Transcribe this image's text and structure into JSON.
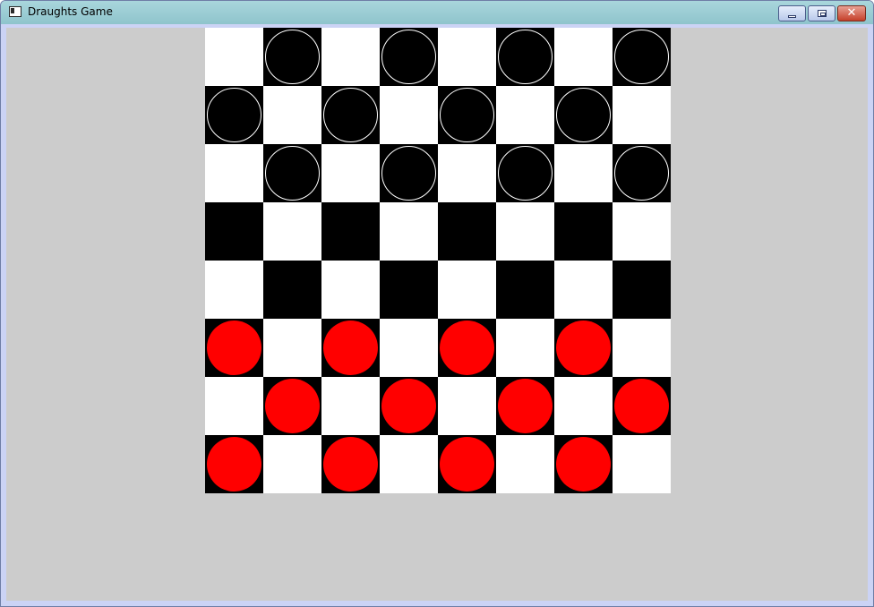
{
  "window": {
    "title": "Draughts Game",
    "controls": {
      "minimize": "minimize",
      "maximize": "maximize",
      "close": "✕"
    }
  },
  "colors": {
    "light_square": "#ffffff",
    "dark_square": "#000000",
    "black_piece": "#000000",
    "black_piece_outline": "#ffffff",
    "red_piece": "#ff0000",
    "background": "#cccccc"
  },
  "board": {
    "size": 8,
    "first_square_dark": false,
    "pieces": [
      [
        null,
        "black",
        null,
        "black",
        null,
        "black",
        null,
        "black"
      ],
      [
        "black",
        null,
        "black",
        null,
        "black",
        null,
        "black",
        null
      ],
      [
        null,
        "black",
        null,
        "black",
        null,
        "black",
        null,
        "black"
      ],
      [
        null,
        null,
        null,
        null,
        null,
        null,
        null,
        null
      ],
      [
        null,
        null,
        null,
        null,
        null,
        null,
        null,
        null
      ],
      [
        "red",
        null,
        "red",
        null,
        "red",
        null,
        "red",
        null
      ],
      [
        null,
        "red",
        null,
        "red",
        null,
        "red",
        null,
        "red"
      ],
      [
        "red",
        null,
        "red",
        null,
        "red",
        null,
        "red",
        null
      ]
    ]
  }
}
